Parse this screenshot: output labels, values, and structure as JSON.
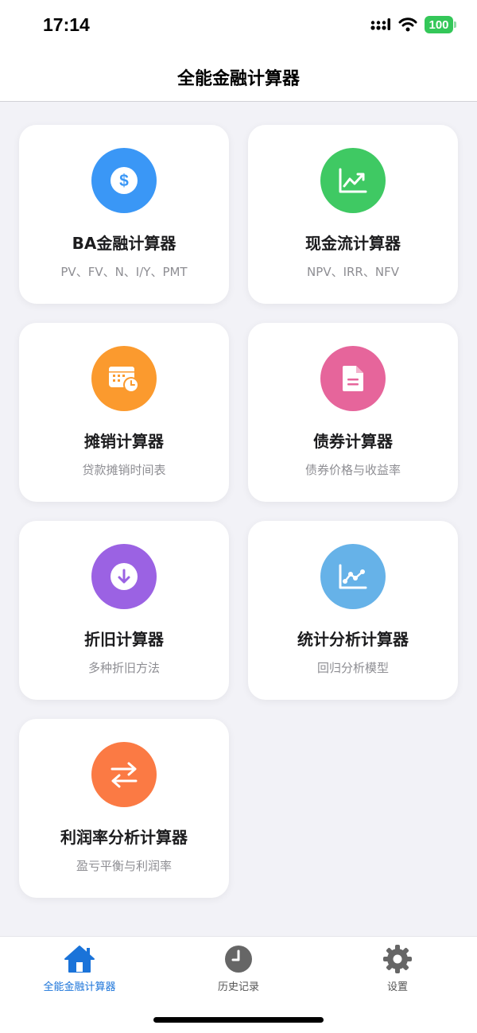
{
  "status_bar": {
    "time": "17:14",
    "battery": "100"
  },
  "header": {
    "title": "全能金融计算器"
  },
  "cards": [
    {
      "title": "BA金融计算器",
      "subtitle": "PV、FV、N、I/Y、PMT",
      "icon": "dollar-icon",
      "color": "#3a97f6"
    },
    {
      "title": "现金流计算器",
      "subtitle": "NPV、IRR、NFV",
      "icon": "trending-chart-icon",
      "color": "#3fc963"
    },
    {
      "title": "摊销计算器",
      "subtitle": "贷款摊销时间表",
      "icon": "calendar-clock-icon",
      "color": "#fb9a2e"
    },
    {
      "title": "债券计算器",
      "subtitle": "债券价格与收益率",
      "icon": "document-icon",
      "color": "#e6659b"
    },
    {
      "title": "折旧计算器",
      "subtitle": "多种折旧方法",
      "icon": "down-arrow-circle-icon",
      "color": "#9b62e3"
    },
    {
      "title": "统计分析计算器",
      "subtitle": "回归分析模型",
      "icon": "line-chart-icon",
      "color": "#66b2e8"
    },
    {
      "title": "利润率分析计算器",
      "subtitle": "盈亏平衡与利润率",
      "icon": "swap-arrows-icon",
      "color": "#fb7a44"
    }
  ],
  "tab_bar": {
    "tabs": [
      {
        "label": "全能金融计算器",
        "icon": "home-icon",
        "active": true
      },
      {
        "label": "历史记录",
        "icon": "clock-icon",
        "active": false
      },
      {
        "label": "设置",
        "icon": "gear-icon",
        "active": false
      }
    ],
    "active_color": "#1a73d9"
  }
}
